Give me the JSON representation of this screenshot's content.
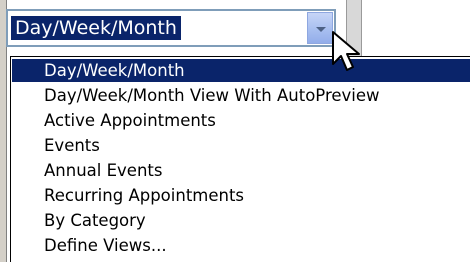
{
  "view_selector": {
    "value": "Day/Week/Month",
    "button_icon": "chevron-down-icon",
    "options": [
      {
        "label": "Day/Week/Month",
        "selected": true
      },
      {
        "label": "Day/Week/Month View With AutoPreview",
        "selected": false
      },
      {
        "label": "Active Appointments",
        "selected": false
      },
      {
        "label": "Events",
        "selected": false
      },
      {
        "label": "Annual Events",
        "selected": false
      },
      {
        "label": "Recurring Appointments",
        "selected": false
      },
      {
        "label": "By Category",
        "selected": false
      },
      {
        "label": "Define Views...",
        "selected": false
      }
    ]
  },
  "colors": {
    "selection": "#0a246a",
    "combo_border": "#7f9db9"
  },
  "cursor_icon": "arrow-pointer-icon"
}
